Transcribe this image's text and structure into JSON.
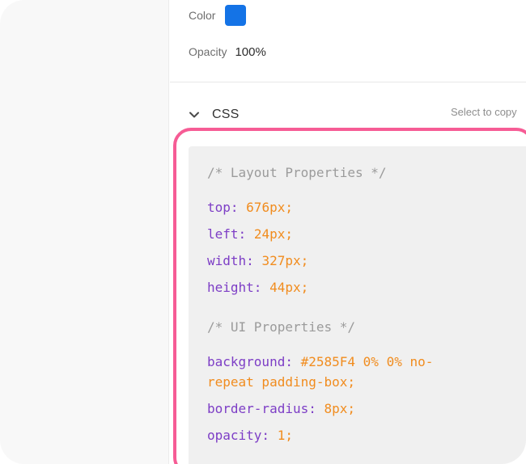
{
  "properties": {
    "color_label": "Color",
    "color_value": "#1473e6",
    "opacity_label": "Opacity",
    "opacity_value": "100%"
  },
  "css_section": {
    "title": "CSS",
    "copy_hint": "Select to copy",
    "expanded": true,
    "highlight_color": "#f65c95",
    "lines": [
      {
        "type": "comment",
        "text": "/* Layout Properties */"
      },
      {
        "type": "decl",
        "prop": "top:",
        "value": "676px;"
      },
      {
        "type": "decl",
        "prop": "left:",
        "value": "24px;"
      },
      {
        "type": "decl",
        "prop": "width:",
        "value": "327px;"
      },
      {
        "type": "decl",
        "prop": "height:",
        "value": "44px;"
      },
      {
        "type": "comment",
        "text": "/* UI Properties */"
      },
      {
        "type": "decl",
        "prop": "background:",
        "value": "#2585F4 0% 0% no-",
        "value_cont": "repeat padding-box;"
      },
      {
        "type": "decl",
        "prop": "border-radius:",
        "value": "8px;"
      },
      {
        "type": "decl",
        "prop": "opacity:",
        "value": "1;"
      }
    ]
  },
  "colors": {
    "property_name": "#7d3ec6",
    "property_value": "#f18c1e",
    "comment": "#9b9b9b"
  }
}
